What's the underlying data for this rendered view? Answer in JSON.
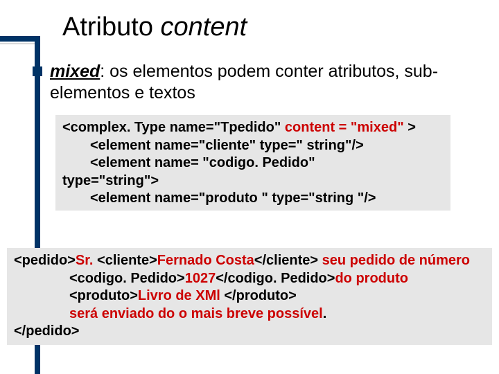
{
  "title": {
    "plain": "Atributo ",
    "italic": "content"
  },
  "bullet": {
    "mixed": "mixed",
    "rest": ": os elementos podem conter atributos, sub-elementos e textos"
  },
  "code1": {
    "l1a": "<complex. Type name=\"Tpedido\" ",
    "l1b": "content = \"mixed\"",
    "l1c": " >",
    "l2": "<element name=\"cliente\" type=\" string\"/>",
    "l3": "<element name= \"codigo. Pedido\" ",
    "l3b": "type=\"string\">",
    "l4": "<element name=\"produto \" type=\"string \"/>"
  },
  "code2": {
    "l1a": "<pedido>",
    "l1b": "Sr. ",
    "l1c": "<cliente>",
    "l1d": "Fernado Costa",
    "l1e": "</cliente> ",
    "l1f": "seu pedido de número",
    "l2a": "<codigo. Pedido>",
    "l2b": "1027",
    "l2c": "</codigo. Pedido>",
    "l2d": "do produto",
    "l3a": "<produto>",
    "l3b": "Livro de XMl ",
    "l3c": "</produto>",
    "l4": "será enviado do o mais breve possível",
    "l4dot": ".",
    "l5": "</pedido>"
  }
}
